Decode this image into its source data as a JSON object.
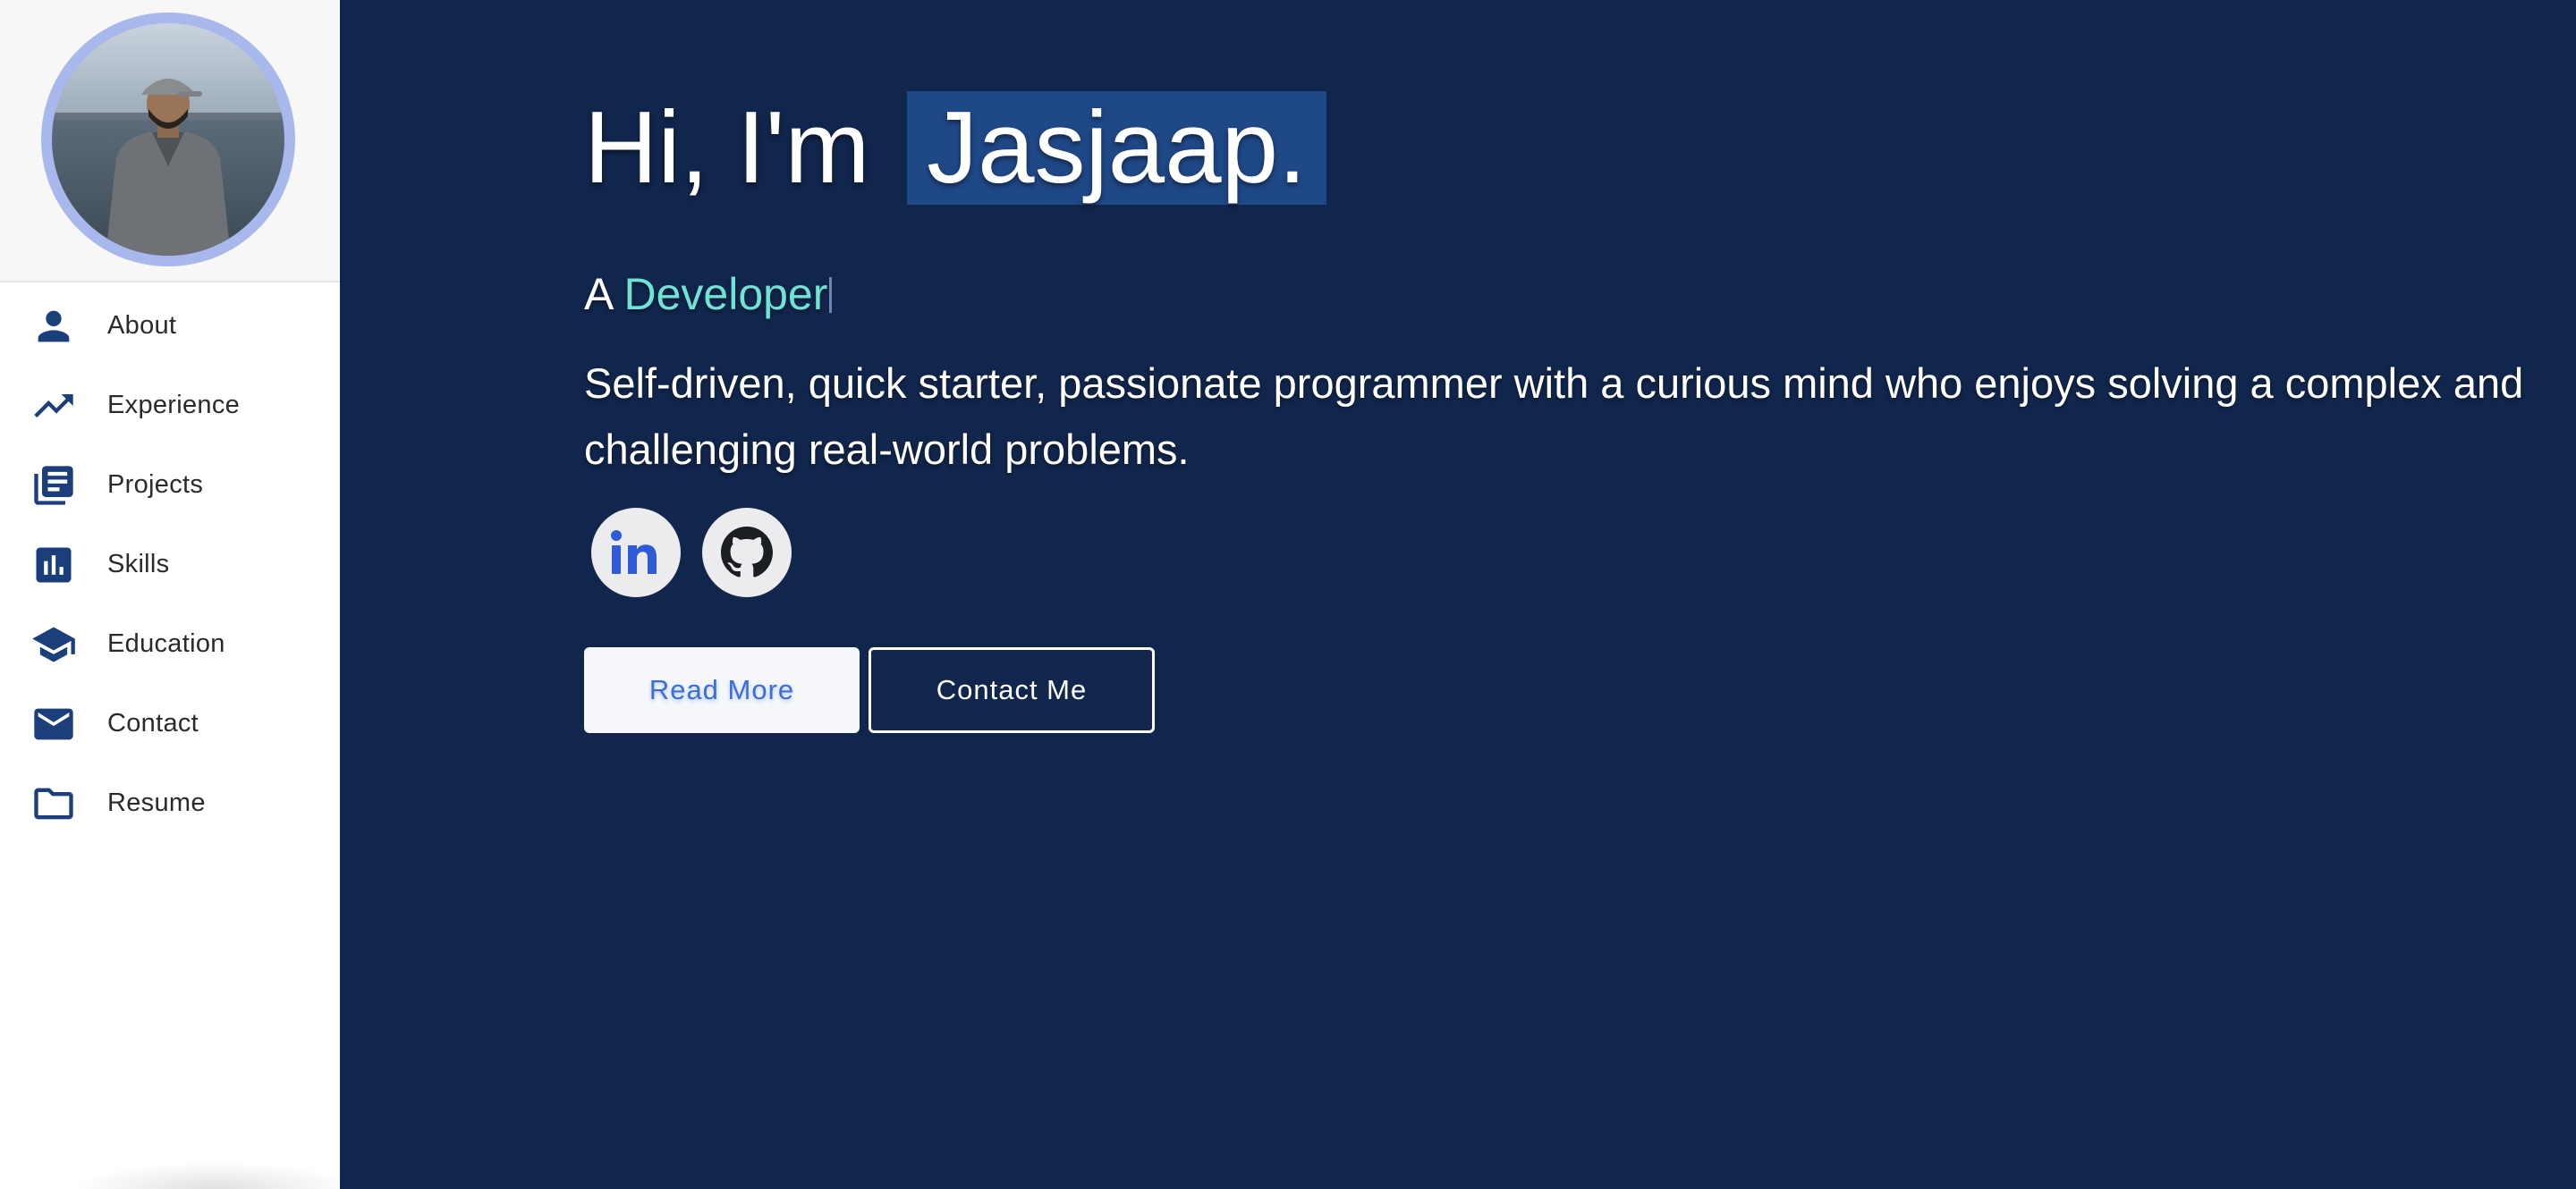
{
  "sidebar": {
    "items": [
      {
        "label": "About",
        "icon": "person-icon"
      },
      {
        "label": "Experience",
        "icon": "trending-up-icon"
      },
      {
        "label": "Projects",
        "icon": "library-books-icon"
      },
      {
        "label": "Skills",
        "icon": "bar-chart-icon"
      },
      {
        "label": "Education",
        "icon": "school-icon"
      },
      {
        "label": "Contact",
        "icon": "mail-icon"
      },
      {
        "label": "Resume",
        "icon": "folder-icon"
      }
    ]
  },
  "hero": {
    "greeting": "Hi, I'm",
    "name": "Jasjaap.",
    "subtitle_prefix": "A",
    "role": "Developer",
    "description": "Self-driven, quick starter, passionate programmer with a curious mind who enjoys solving a complex and challenging real-world problems."
  },
  "social": [
    {
      "icon": "linkedin-icon"
    },
    {
      "icon": "github-icon"
    }
  ],
  "buttons": {
    "read_more": "Read More",
    "contact_me": "Contact Me"
  },
  "colors": {
    "main_bg": "#11264c",
    "accent_role": "#6fe3d6",
    "name_highlight": "#1f4887",
    "nav_icon": "#1b3f7a",
    "avatar_ring": "#a9b8ec"
  }
}
